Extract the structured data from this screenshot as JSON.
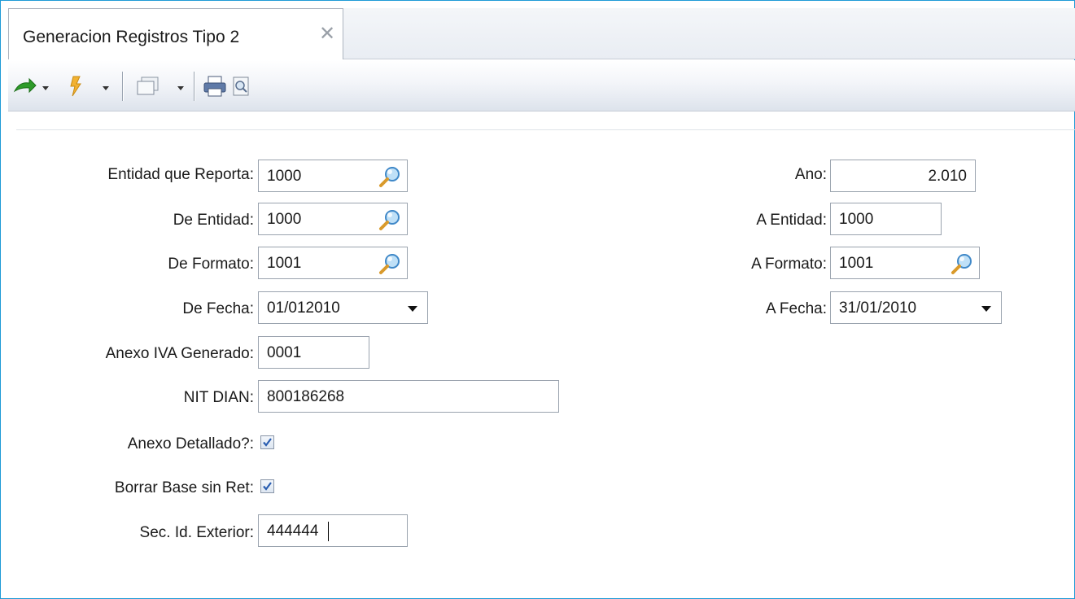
{
  "tab": {
    "title": "Generacion Registros Tipo 2",
    "close_glyph": "✕"
  },
  "toolbar": {
    "icons": [
      "green-arrow-icon",
      "lightning-icon",
      "window-icon",
      "print-icon",
      "print-preview-icon"
    ]
  },
  "form": {
    "entidad_reporta": {
      "label": "Entidad que Reporta:",
      "value": "1000"
    },
    "de_entidad": {
      "label": "De Entidad:",
      "value": "1000"
    },
    "de_formato": {
      "label": "De Formato:",
      "value": "1001"
    },
    "de_fecha": {
      "label": "De Fecha:",
      "value": "01/012010"
    },
    "anexo_iva": {
      "label": "Anexo IVA Generado:",
      "value": "0001"
    },
    "nit_dian": {
      "label": "NIT DIAN:",
      "value": "800186268"
    },
    "anexo_detallado": {
      "label": "Anexo Detallado?:",
      "checked": true
    },
    "borrar_base": {
      "label": "Borrar Base sin Ret:",
      "checked": true
    },
    "sec_id_exterior": {
      "label": "Sec. Id. Exterior:",
      "value": "444444"
    },
    "ano": {
      "label": "Ano:",
      "value": "2.010"
    },
    "a_entidad": {
      "label": "A Entidad:",
      "value": "1000"
    },
    "a_formato": {
      "label": "A Formato:",
      "value": "1001"
    },
    "a_fecha": {
      "label": "A Fecha:",
      "value": "31/01/2010"
    }
  },
  "colors": {
    "frame_border": "#1e9ad6",
    "checkbox_check": "#2a5db0"
  }
}
